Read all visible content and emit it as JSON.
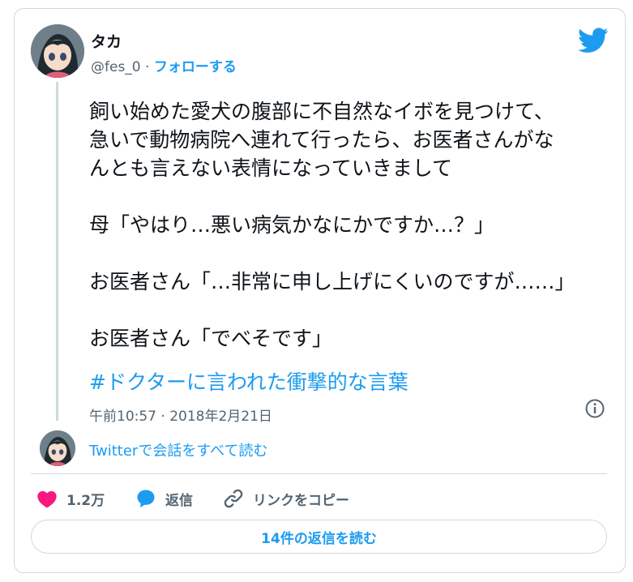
{
  "colors": {
    "accent": "#1d9bf0",
    "text": "#0f1419",
    "secondary_text": "#536471",
    "border": "#cfd9de",
    "like": "#f91880"
  },
  "author": {
    "name": "タカ",
    "handle": "@fes_0",
    "separator": " · ",
    "follow_label": "フォローする"
  },
  "tweet": {
    "lines": [
      "飼い始めた愛犬の腹部に不自然なイボを見つけて、",
      "急いで動物病院へ連れて行ったら、お医者さんがな",
      "んとも言えない表情になっていきまして",
      "母「やはり…悪い病気かなにかですか…？」",
      "お医者さん「…非常に申し上げにくいのですが……」",
      "お医者さん「でべそです」"
    ],
    "hashtag": "#ドクターに言われた衝撃的な言葉",
    "timestamp": "午前10:57 · 2018年2月21日"
  },
  "conversation_link": "Twitterで会話をすべて読む",
  "actions": {
    "like_count": "1.2万",
    "reply_label": "返信",
    "copy_link_label": "リンクをコピー"
  },
  "replies_button_label": "14件の返信を読む",
  "icons": {
    "brand": "twitter-bird-icon",
    "info": "info-icon",
    "like": "heart-icon",
    "reply": "speech-bubble-icon",
    "copy": "link-icon"
  }
}
